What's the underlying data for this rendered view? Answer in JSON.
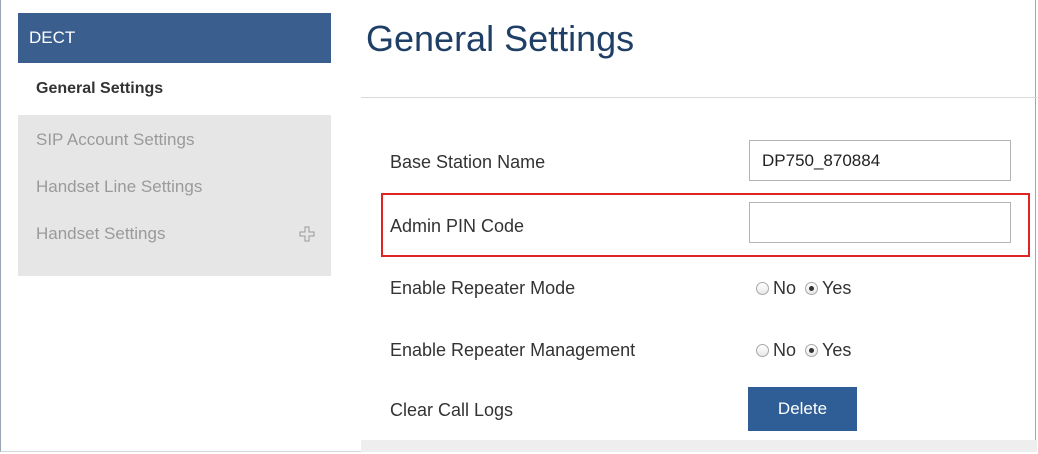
{
  "sidebar": {
    "header": "DECT",
    "active_item": "General Settings",
    "items": [
      {
        "label": "SIP Account Settings",
        "expandable": false
      },
      {
        "label": "Handset Line Settings",
        "expandable": false
      },
      {
        "label": "Handset Settings",
        "expandable": true,
        "expand_icon": "plus-icon"
      }
    ]
  },
  "main": {
    "title": "General Settings",
    "fields": {
      "base_station_name": {
        "label": "Base Station Name",
        "value": "DP750_870884"
      },
      "admin_pin_code": {
        "label": "Admin PIN Code",
        "value": ""
      },
      "enable_repeater_mode": {
        "label": "Enable Repeater Mode",
        "options": [
          "No",
          "Yes"
        ],
        "selected": "Yes"
      },
      "enable_repeater_management": {
        "label": "Enable Repeater Management",
        "options": [
          "No",
          "Yes"
        ],
        "selected": "Yes"
      },
      "clear_call_logs": {
        "label": "Clear Call Logs",
        "button": "Delete"
      }
    }
  },
  "colors": {
    "sidebar_header_bg": "#3a5f8f",
    "title_color": "#1f3f66",
    "button_bg": "#2f5d95",
    "highlight_border": "#e02424"
  }
}
